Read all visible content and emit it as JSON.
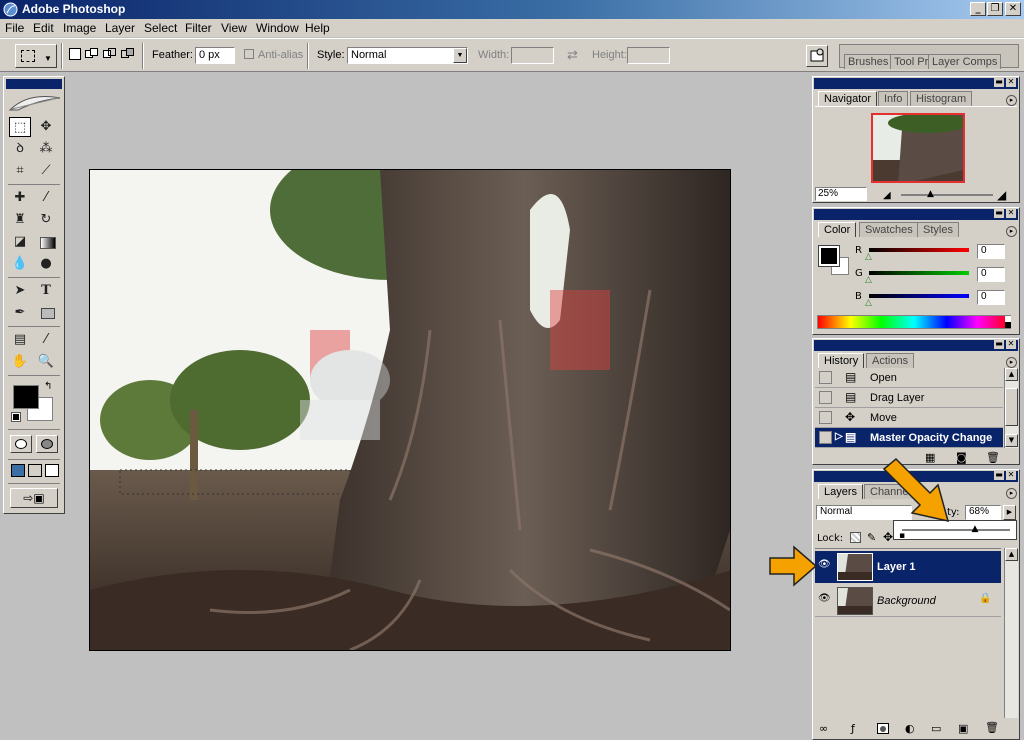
{
  "app": {
    "title": "Adobe Photoshop"
  },
  "menu": [
    "File",
    "Edit",
    "Image",
    "Layer",
    "Select",
    "Filter",
    "View",
    "Window",
    "Help"
  ],
  "options": {
    "feather_label": "Feather:",
    "feather_value": "0 px",
    "antialias_label": "Anti-alias",
    "style_label": "Style:",
    "style_value": "Normal",
    "width_label": "Width:",
    "height_label": "Height:"
  },
  "palette_well": [
    "Brushes",
    "Tool Pr",
    "Layer Comps"
  ],
  "navigator": {
    "tabs": [
      "Navigator",
      "Info",
      "Histogram"
    ],
    "zoom": "25%"
  },
  "color": {
    "tabs": [
      "Color",
      "Swatches",
      "Styles"
    ],
    "r_label": "R",
    "g_label": "G",
    "b_label": "B",
    "r": "0",
    "g": "0",
    "b": "0"
  },
  "history": {
    "tabs": [
      "History",
      "Actions"
    ],
    "items": [
      "Open",
      "Drag Layer",
      "Move",
      "Master Opacity Change"
    ],
    "selected": 3
  },
  "layers": {
    "tabs": [
      "Layers",
      "Channels"
    ],
    "blend_mode": "Normal",
    "opacity_label": "ty:",
    "opacity": "68%",
    "opacity_value": 0.68,
    "lock_label": "Lock:",
    "items": [
      {
        "name": "Layer 1",
        "selected": true
      },
      {
        "name": "Background",
        "locked": true
      }
    ]
  },
  "colors": {
    "selection": "#0a246a",
    "arrow": "#f5a100",
    "panel": "#d4d0c8"
  }
}
